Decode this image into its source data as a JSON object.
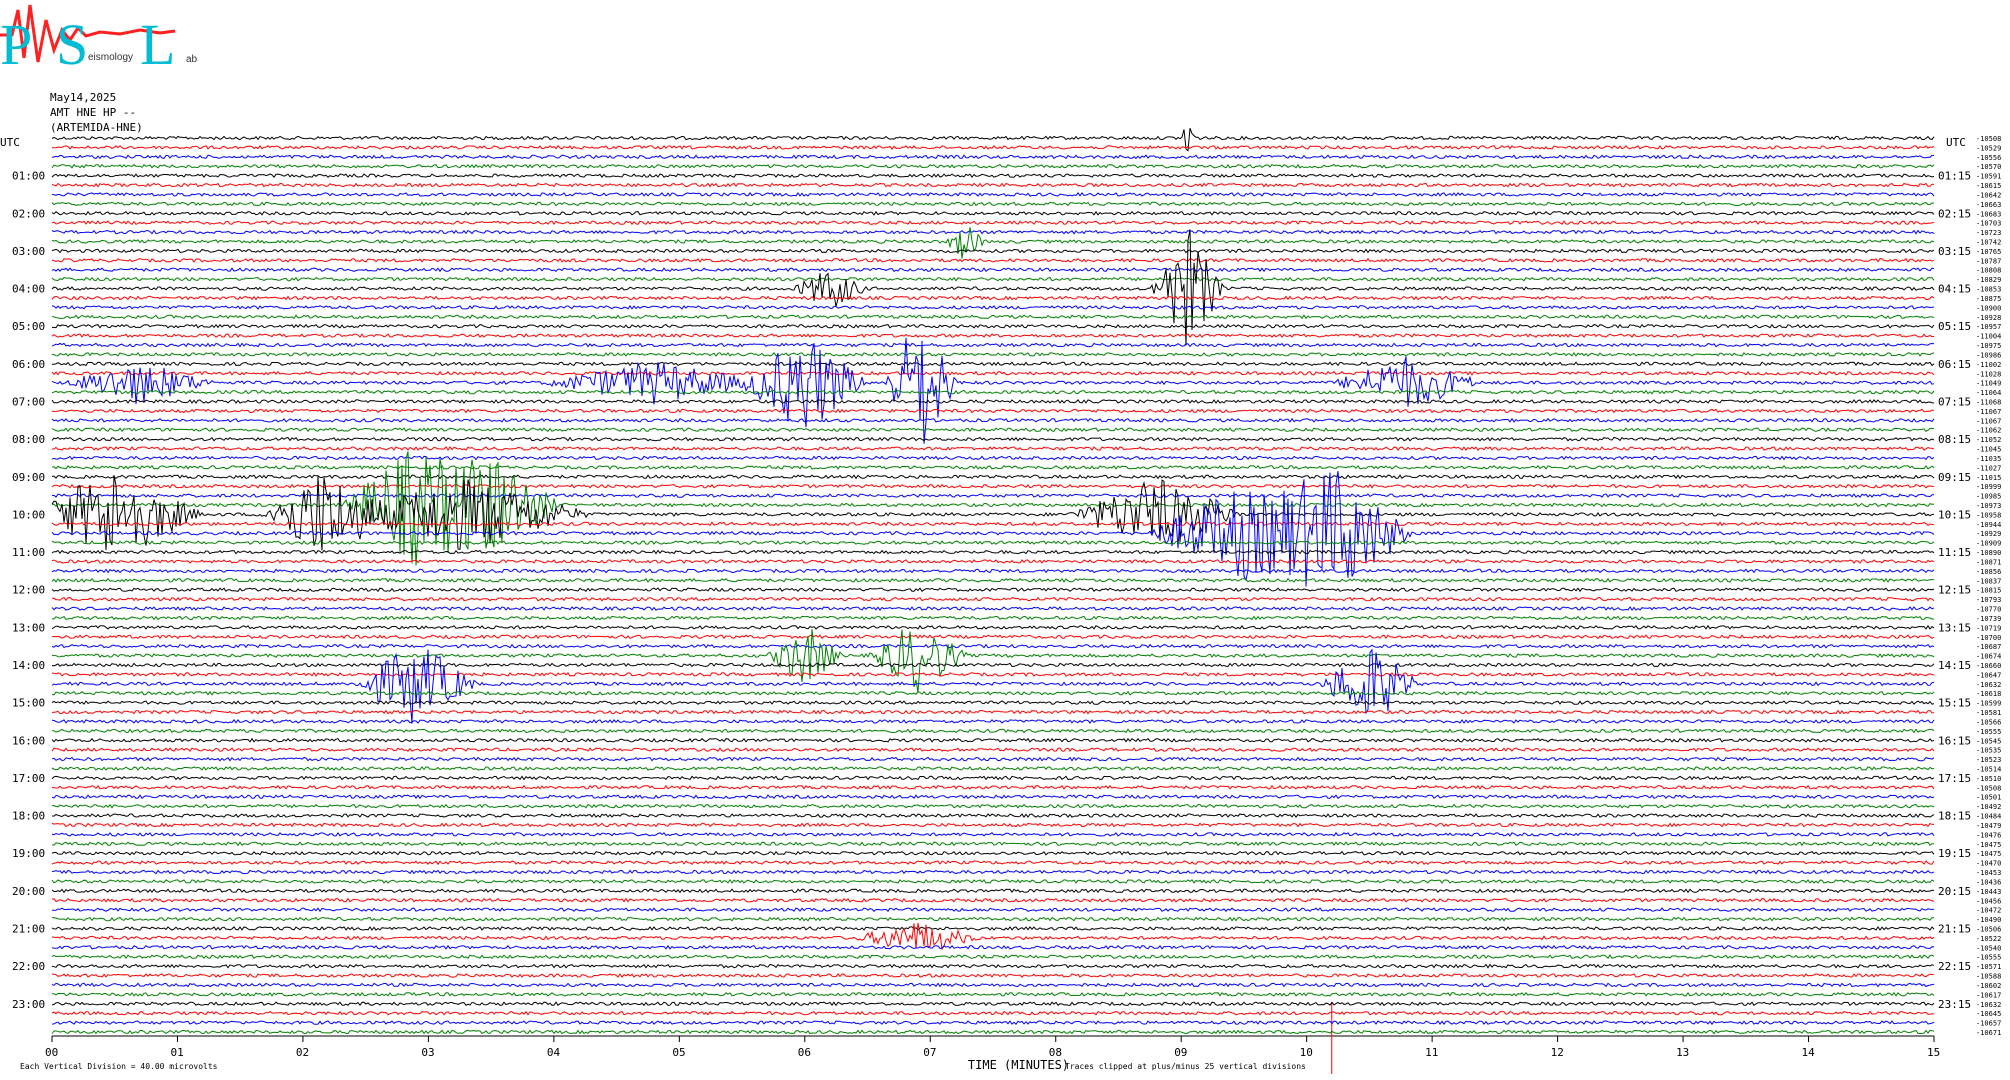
{
  "header": {
    "date": "May14,2025",
    "station": "AMT HNE HP --",
    "network": "(ARTEMIDA-HNE)"
  },
  "logo": {
    "letters": [
      "P",
      "S",
      "L"
    ],
    "text_fragments": [
      "eismology",
      "ab"
    ]
  },
  "footer": {
    "scale_note": "Each Vertical Division =   40.00 microvolts",
    "clip_note": "Traces clipped at plus/minus 25 vertical divisions"
  },
  "colors": {
    "trace_cycle": [
      "#000000",
      "#ff0000",
      "#0000ff",
      "#008000"
    ],
    "tick": "#808080",
    "marker": "#ff0000"
  },
  "chart_data": {
    "type": "line",
    "xlabel": "TIME (MINUTES)",
    "xlim": [
      0,
      15
    ],
    "x_ticks": [
      "00",
      "01",
      "02",
      "03",
      "04",
      "05",
      "06",
      "07",
      "08",
      "09",
      "10",
      "11",
      "12",
      "13",
      "14",
      "15"
    ],
    "rows_per_hour": 4,
    "row_count": 96,
    "trace_color_cycle": [
      "black",
      "red",
      "blue",
      "green"
    ],
    "left_axis_label": "UTC",
    "right_axis_label": "UTC",
    "left_hour_labels": [
      "01:00",
      "02:00",
      "03:00",
      "04:00",
      "05:00",
      "06:00",
      "07:00",
      "08:00",
      "09:00",
      "10:00",
      "11:00",
      "12:00",
      "13:00",
      "14:00",
      "15:00",
      "16:00",
      "17:00",
      "18:00",
      "19:00",
      "20:00",
      "21:00",
      "22:00",
      "23:00"
    ],
    "right_hour_labels": [
      "01:15",
      "02:15",
      "03:15",
      "04:15",
      "05:15",
      "06:15",
      "07:15",
      "08:15",
      "09:15",
      "10:15",
      "11:15",
      "12:15",
      "13:15",
      "14:15",
      "15:15",
      "16:15",
      "17:15",
      "18:15",
      "19:15",
      "20:15",
      "21:15",
      "22:15",
      "23:15"
    ],
    "row_offsets": [
      "-10508",
      "-10529",
      "-10556",
      "-10570",
      "-10591",
      "-10615",
      "-10642",
      "-10663",
      "-10683",
      "-10703",
      "-10723",
      "-10742",
      "-10765",
      "-10787",
      "-10808",
      "-10829",
      "-10853",
      "-10875",
      "-10900",
      "-10928",
      "-10957",
      "-11004",
      "-10975",
      "-10986",
      "-11002",
      "-11028",
      "-11049",
      "-11064",
      "-11068",
      "-11067",
      "-11067",
      "-11062",
      "-11052",
      "-11045",
      "-11035",
      "-11027",
      "-11015",
      "-10999",
      "-10985",
      "-10973",
      "-10958",
      "-10944",
      "-10929",
      "-10909",
      "-10890",
      "-10871",
      "-10856",
      "-10837",
      "-10815",
      "-10793",
      "-10770",
      "-10739",
      "-10719",
      "-10700",
      "-10687",
      "-10674",
      "-10660",
      "-10647",
      "-10632",
      "-10618",
      "-10599",
      "-10581",
      "-10566",
      "-10555",
      "-10545",
      "-10535",
      "-10523",
      "-10514",
      "-10510",
      "-10508",
      "-10501",
      "-10492",
      "-10484",
      "-10479",
      "-10476",
      "-10475",
      "-10475",
      "-10470",
      "-10453",
      "-10436",
      "-10443",
      "-10456",
      "-10472",
      "-10490",
      "-10506",
      "-10522",
      "-10540",
      "-10555",
      "-10571",
      "-10588",
      "-10602",
      "-10617",
      "-10632",
      "-10645",
      "-10657",
      "-10671"
    ],
    "events": [
      {
        "row": 0,
        "t": 9.06,
        "amp": 14,
        "dur": 0.05,
        "series": "black",
        "note": "clipped spike"
      },
      {
        "row": 11,
        "t": 7.28,
        "amp": 4,
        "dur": 0.15,
        "series": "red"
      },
      {
        "row": 16,
        "t": 6.2,
        "amp": 4,
        "dur": 0.3,
        "series": "black"
      },
      {
        "row": 16,
        "t": 9.05,
        "amp": 12,
        "dur": 0.3,
        "series": "black"
      },
      {
        "row": 26,
        "t": 0.7,
        "amp": 4,
        "dur": 0.6,
        "series": "blue"
      },
      {
        "row": 26,
        "t": 4.8,
        "amp": 4,
        "dur": 0.9,
        "series": "blue"
      },
      {
        "row": 26,
        "t": 6.0,
        "amp": 10,
        "dur": 0.5,
        "series": "blue"
      },
      {
        "row": 26,
        "t": 6.92,
        "amp": 14,
        "dur": 0.3,
        "series": "blue"
      },
      {
        "row": 26,
        "t": 10.8,
        "amp": 5,
        "dur": 0.6,
        "series": "blue"
      },
      {
        "row": 39,
        "t": 2.9,
        "amp": 12,
        "dur": 0.6,
        "series": "red"
      },
      {
        "row": 39,
        "t": 3.55,
        "amp": 10,
        "dur": 0.5,
        "series": "red"
      },
      {
        "row": 40,
        "t": 0.5,
        "amp": 9,
        "dur": 0.7,
        "series": "green"
      },
      {
        "row": 40,
        "t": 2.15,
        "amp": 9,
        "dur": 0.5,
        "series": "green"
      },
      {
        "row": 40,
        "t": 3.3,
        "amp": 7,
        "dur": 1.0,
        "series": "green"
      },
      {
        "row": 40,
        "t": 8.8,
        "amp": 7,
        "dur": 0.7,
        "series": "green"
      },
      {
        "row": 42,
        "t": 9.5,
        "amp": 9,
        "dur": 0.8,
        "series": "blue"
      },
      {
        "row": 42,
        "t": 10.25,
        "amp": 12,
        "dur": 0.6,
        "series": "blue"
      },
      {
        "row": 55,
        "t": 6.0,
        "amp": 6,
        "dur": 0.3,
        "series": "green"
      },
      {
        "row": 55,
        "t": 6.9,
        "amp": 7,
        "dur": 0.4,
        "series": "green"
      },
      {
        "row": 58,
        "t": 2.9,
        "amp": 8,
        "dur": 0.5,
        "series": "green"
      },
      {
        "row": 58,
        "t": 10.5,
        "amp": 8,
        "dur": 0.4,
        "series": "blue"
      },
      {
        "row": 85,
        "t": 6.9,
        "amp": 3,
        "dur": 0.5,
        "series": "black"
      }
    ]
  }
}
